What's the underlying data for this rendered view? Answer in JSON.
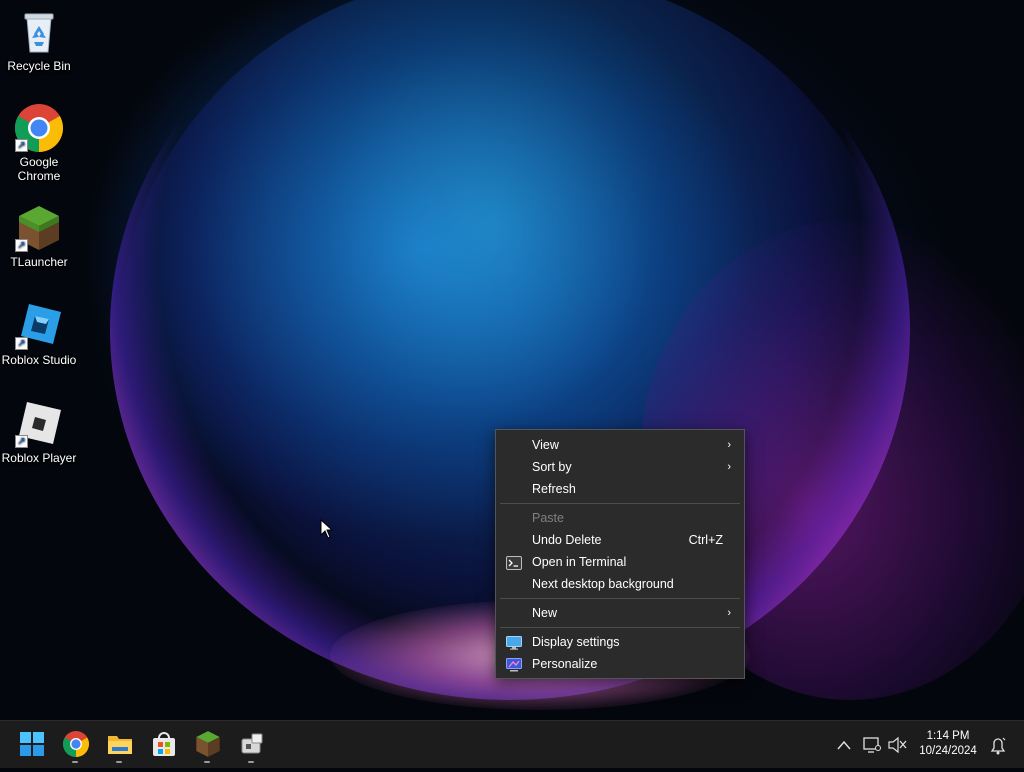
{
  "desktop": {
    "icons": [
      {
        "label": "Recycle Bin",
        "icon": "recycle-bin-icon"
      },
      {
        "label": "Google Chrome",
        "label_line1": "Google",
        "label_line2": "Chrome",
        "icon": "chrome-icon"
      },
      {
        "label": "TLauncher",
        "icon": "tlauncher-icon"
      },
      {
        "label": "Roblox Studio",
        "icon": "roblox-studio-icon"
      },
      {
        "label": "Roblox Player",
        "icon": "roblox-player-icon"
      }
    ]
  },
  "context_menu": {
    "items": [
      {
        "label": "View",
        "submenu": true
      },
      {
        "label": "Sort by",
        "submenu": true
      },
      {
        "label": "Refresh"
      },
      {
        "label": "Paste",
        "disabled": true
      },
      {
        "label": "Undo Delete",
        "shortcut": "Ctrl+Z"
      },
      {
        "label": "Open in Terminal",
        "icon": "terminal-icon"
      },
      {
        "label": "Next desktop background"
      },
      {
        "label": "New",
        "submenu": true
      },
      {
        "label": "Display settings",
        "icon": "display-icon"
      },
      {
        "label": "Personalize",
        "icon": "personalize-icon"
      }
    ],
    "submenu_glyph": "›"
  },
  "taskbar": {
    "apps": [
      "start-icon",
      "chrome-icon",
      "file-explorer-icon",
      "microsoft-store-icon",
      "tlauncher-icon",
      "roblox-studio-icon"
    ],
    "tray": {
      "overflow_glyph": "^",
      "time": "1:14 PM",
      "date": "10/24/2024"
    }
  },
  "colors": {
    "menu_bg": "#2b2b2b",
    "taskbar_bg": "#1c1c1c",
    "disabled_text": "#808080"
  }
}
